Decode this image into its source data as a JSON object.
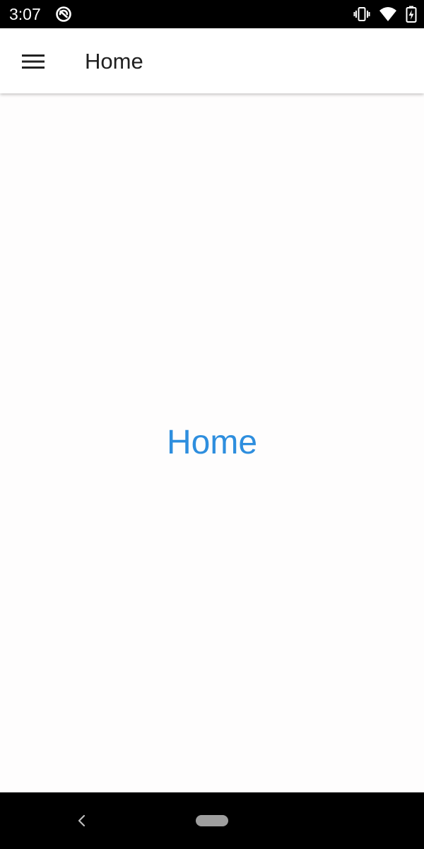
{
  "status_bar": {
    "time": "3:07",
    "icons": [
      "at-sign-icon",
      "vibrate-icon",
      "wifi-icon",
      "battery-charging-icon"
    ]
  },
  "app_bar": {
    "title": "Home",
    "menu_icon": "hamburger-menu-icon"
  },
  "content": {
    "center_text": "Home",
    "accent_color": "#2e8ede"
  },
  "nav_bar": {
    "icons": [
      "back-icon",
      "home-pill-icon"
    ]
  }
}
